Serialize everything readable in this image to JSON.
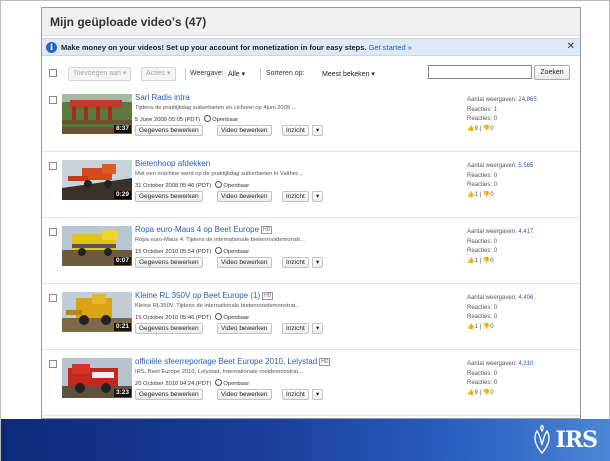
{
  "header": {
    "title": "Mijn geüploade video's (47)"
  },
  "banner": {
    "info_icon": "i",
    "message": "Make money on your videos! Set up your account for monetization in four easy steps.",
    "link": "Get started »",
    "close": "✕"
  },
  "toolbar": {
    "add_to": "Toevoegen aan ▾",
    "actions": "Acties ▾",
    "view_label": "Weergave:",
    "view_value": "Alle ▾",
    "sort_label": "Sorteren op:",
    "sort_value": "Meest bekeken ▾",
    "search_placeholder": "",
    "search_button": "Zoeken"
  },
  "labels": {
    "edit_info": "Gegevens bewerken",
    "edit_video": "Video bewerken",
    "insight": "Inzicht",
    "dropdown": "▾",
    "views": "Aantal weergaven:",
    "comments": "Reacties:",
    "favorites": "Reacties:",
    "public": "Openbaar",
    "hd": "HD"
  },
  "videos": [
    {
      "title": "Sarl Radis intra",
      "hd": false,
      "desc": "Tijdens de praktijkdag suikerbieten en cichorei op 4juni 2009 ...",
      "date": "5 June 2009 05:05 (PDT)",
      "duration": "8:37",
      "views": "24,865",
      "comments": "1",
      "favorites": "0",
      "likes": "9",
      "dislikes": "0"
    },
    {
      "title": "Bietenhoop afdekken",
      "hd": false,
      "desc": "Met een machine werd op de praktijkdag suikerbieten in Valther...",
      "date": "31 October 2008 05:46 (PDT)",
      "duration": "0:29",
      "views": "5,565",
      "comments": "0",
      "favorites": "0",
      "likes": "1",
      "dislikes": "0"
    },
    {
      "title": "Ropa euro-Maus 4 op Beet Europe",
      "hd": true,
      "desc": "Ropa euro-Maus 4. Tijdens de internationale bietenrooidemonstr...",
      "date": "15 October 2010 05:54 (PDT)",
      "duration": "0:07",
      "views": "4,417",
      "comments": "0",
      "favorites": "0",
      "likes": "1",
      "dislikes": "0"
    },
    {
      "title": "Kleine RL 350V op Beet Europe (1)",
      "hd": true,
      "desc": "Kleine RL350V. Tijdens de internationale bietenrooidemonstrat...",
      "date": "15 October 2010 05:46 (PDT)",
      "duration": "0:21",
      "views": "4,406",
      "comments": "0",
      "favorites": "0",
      "likes": "1",
      "dislikes": "0"
    },
    {
      "title": "officiële sfeerreportage Beet Europe 2010, Lelystad",
      "hd": true,
      "desc": "IRS, Beet Europe 2010, Lelystad, Internationale rooidemonstrat...",
      "date": "20 October 2010 04:24 (PDT)",
      "duration": "3:23",
      "views": "4,210",
      "comments": "0",
      "favorites": "0",
      "likes": "9",
      "dislikes": "0"
    }
  ],
  "footer": {
    "logo_text": "IRS"
  },
  "colors": {
    "link": "#2a5db0",
    "banner_bg": "#dfe9f5",
    "footer_dark": "#0d2a7a",
    "footer_light": "#4d86d6"
  }
}
